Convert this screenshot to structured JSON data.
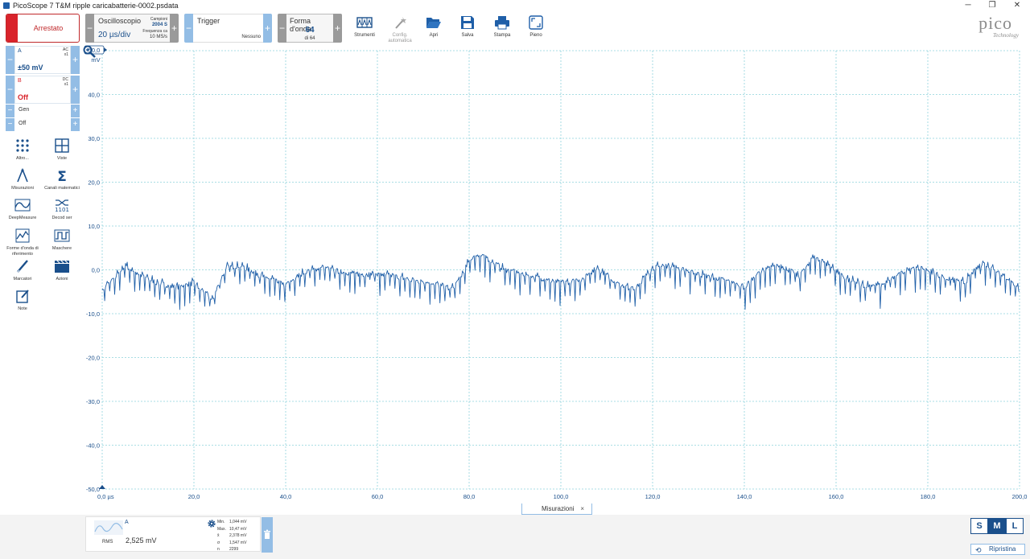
{
  "window": {
    "title": "PicoScope 7 T&M ripple caricabatterie-0002.psdata",
    "controls": [
      "─",
      "❐",
      "✕"
    ]
  },
  "toolbar": {
    "run_state": "Arrestato",
    "scope": {
      "title": "Oscilloscopio",
      "timebase": "20 µs/div",
      "samples_label": "Campioni",
      "samples_value": "2004 S",
      "freq_label": "Frequenza ca",
      "freq_value": "10 MS/s"
    },
    "trigger": {
      "title": "Trigger",
      "value": "Nessuno"
    },
    "waveforms": {
      "title": "Forma d'onda",
      "current": "64",
      "of": "di 64"
    },
    "tools": [
      {
        "id": "instruments",
        "label": "Strumenti",
        "icon": "instruments-icon",
        "enabled": true
      },
      {
        "id": "autoconfig",
        "label": "Config. automatica",
        "icon": "wand-icon",
        "enabled": false
      },
      {
        "id": "open",
        "label": "Apri",
        "icon": "folder-open-icon",
        "enabled": true
      },
      {
        "id": "save",
        "label": "Salva",
        "icon": "save-icon",
        "enabled": true
      },
      {
        "id": "print",
        "label": "Stampa",
        "icon": "print-icon",
        "enabled": true
      },
      {
        "id": "fullscreen",
        "label": "Pieno",
        "icon": "fullscreen-icon",
        "enabled": true
      }
    ],
    "logo_word": "pico",
    "logo_sub": "Technology"
  },
  "channels": [
    {
      "name": "A",
      "coupling": "AC",
      "probe": "x1",
      "range": "±50 mV",
      "color": "#1a4f8b"
    },
    {
      "name": "B",
      "coupling": "DC",
      "probe": "x1",
      "range": "Off",
      "color": "#d9232b"
    }
  ],
  "generator": {
    "label": "Gen",
    "state": "Off"
  },
  "side_tools": [
    {
      "label": "Altro...",
      "icon": "dots-grid-icon"
    },
    {
      "label": "Viste",
      "icon": "views-grid-icon"
    },
    {
      "label": "Misurazioni",
      "icon": "calipers-icon"
    },
    {
      "label": "Canali matematici",
      "icon": "sigma-icon"
    },
    {
      "label": "DeepMeasure",
      "icon": "deepmeasure-icon"
    },
    {
      "label": "Decod ser",
      "icon": "serial-decode-icon"
    },
    {
      "label": "Forme d'onda di riferimento",
      "icon": "reference-waveform-icon"
    },
    {
      "label": "Maschere",
      "icon": "mask-icon"
    },
    {
      "label": "Marcatori",
      "icon": "ruler-pencil-icon"
    },
    {
      "label": "Azioni",
      "icon": "clapper-icon"
    },
    {
      "label": "Note",
      "icon": "note-icon"
    }
  ],
  "chart_data": {
    "type": "line",
    "title": "",
    "xlabel": "",
    "ylabel": "mV",
    "x_unit": "µs",
    "xlim": [
      0,
      200
    ],
    "ylim": [
      -50,
      50
    ],
    "x_ticks": [
      "0,0",
      "20,0",
      "40,0",
      "60,0",
      "80,0",
      "100,0",
      "120,0",
      "140,0",
      "160,0",
      "180,0",
      "200,0"
    ],
    "y_ticks": [
      "50,0",
      "40,0",
      "30,0",
      "20,0",
      "10,0",
      "0,0",
      "-10,0",
      "-20,0",
      "-30,0",
      "-40,0",
      "-50,0"
    ],
    "first_x_tick": "0,0 µs",
    "grid": true,
    "series": [
      {
        "name": "A",
        "color": "#1f5fa8",
        "x": [
          0,
          3,
          5,
          8,
          12,
          16,
          20,
          24,
          27,
          30,
          35,
          40,
          44,
          48,
          52,
          56,
          60,
          64,
          68,
          72,
          76,
          78,
          80,
          82,
          85,
          88,
          92,
          96,
          100,
          104,
          108,
          112,
          116,
          120,
          124,
          128,
          132,
          136,
          140,
          144,
          148,
          152,
          155,
          158,
          162,
          166,
          170,
          174,
          176,
          180,
          184,
          188,
          190,
          192,
          195,
          198,
          200
        ],
        "y": [
          -4.5,
          -1.5,
          1,
          -1,
          -3,
          -4,
          -3,
          -7,
          0.5,
          1,
          -1.5,
          -3.5,
          -0.5,
          0.5,
          -0.5,
          -1,
          -1,
          -1.5,
          -2.5,
          -3,
          -4.5,
          -2,
          2,
          3.5,
          2,
          0,
          -1,
          -2,
          -3,
          -2.5,
          0.5,
          -3,
          -4.5,
          0.5,
          1,
          -0.5,
          -1.5,
          -2.5,
          -4,
          0,
          1,
          -1.5,
          3,
          1.5,
          -2,
          -3.5,
          -3.5,
          -1,
          0.5,
          0,
          -2,
          -3,
          -0.5,
          1.5,
          0,
          -2.5,
          -4.5
        ]
      }
    ]
  },
  "measurements_tab": {
    "label": "Misurazioni",
    "close": "×"
  },
  "measurement": {
    "type": "RMS",
    "channel": "A",
    "value": "2,525 mV",
    "stats": [
      {
        "k": "Min.",
        "v": "1,044 mV"
      },
      {
        "k": "Max.",
        "v": "10,47 mV"
      },
      {
        "k": "x̄",
        "v": "2,378 mV"
      },
      {
        "k": "σ",
        "v": "1,547 mV"
      },
      {
        "k": "n",
        "v": "2299"
      }
    ]
  },
  "size_buttons": [
    {
      "label": "S",
      "active": false
    },
    {
      "label": "M",
      "active": true
    },
    {
      "label": "L",
      "active": false
    }
  ],
  "restore_label": "Ripristina"
}
